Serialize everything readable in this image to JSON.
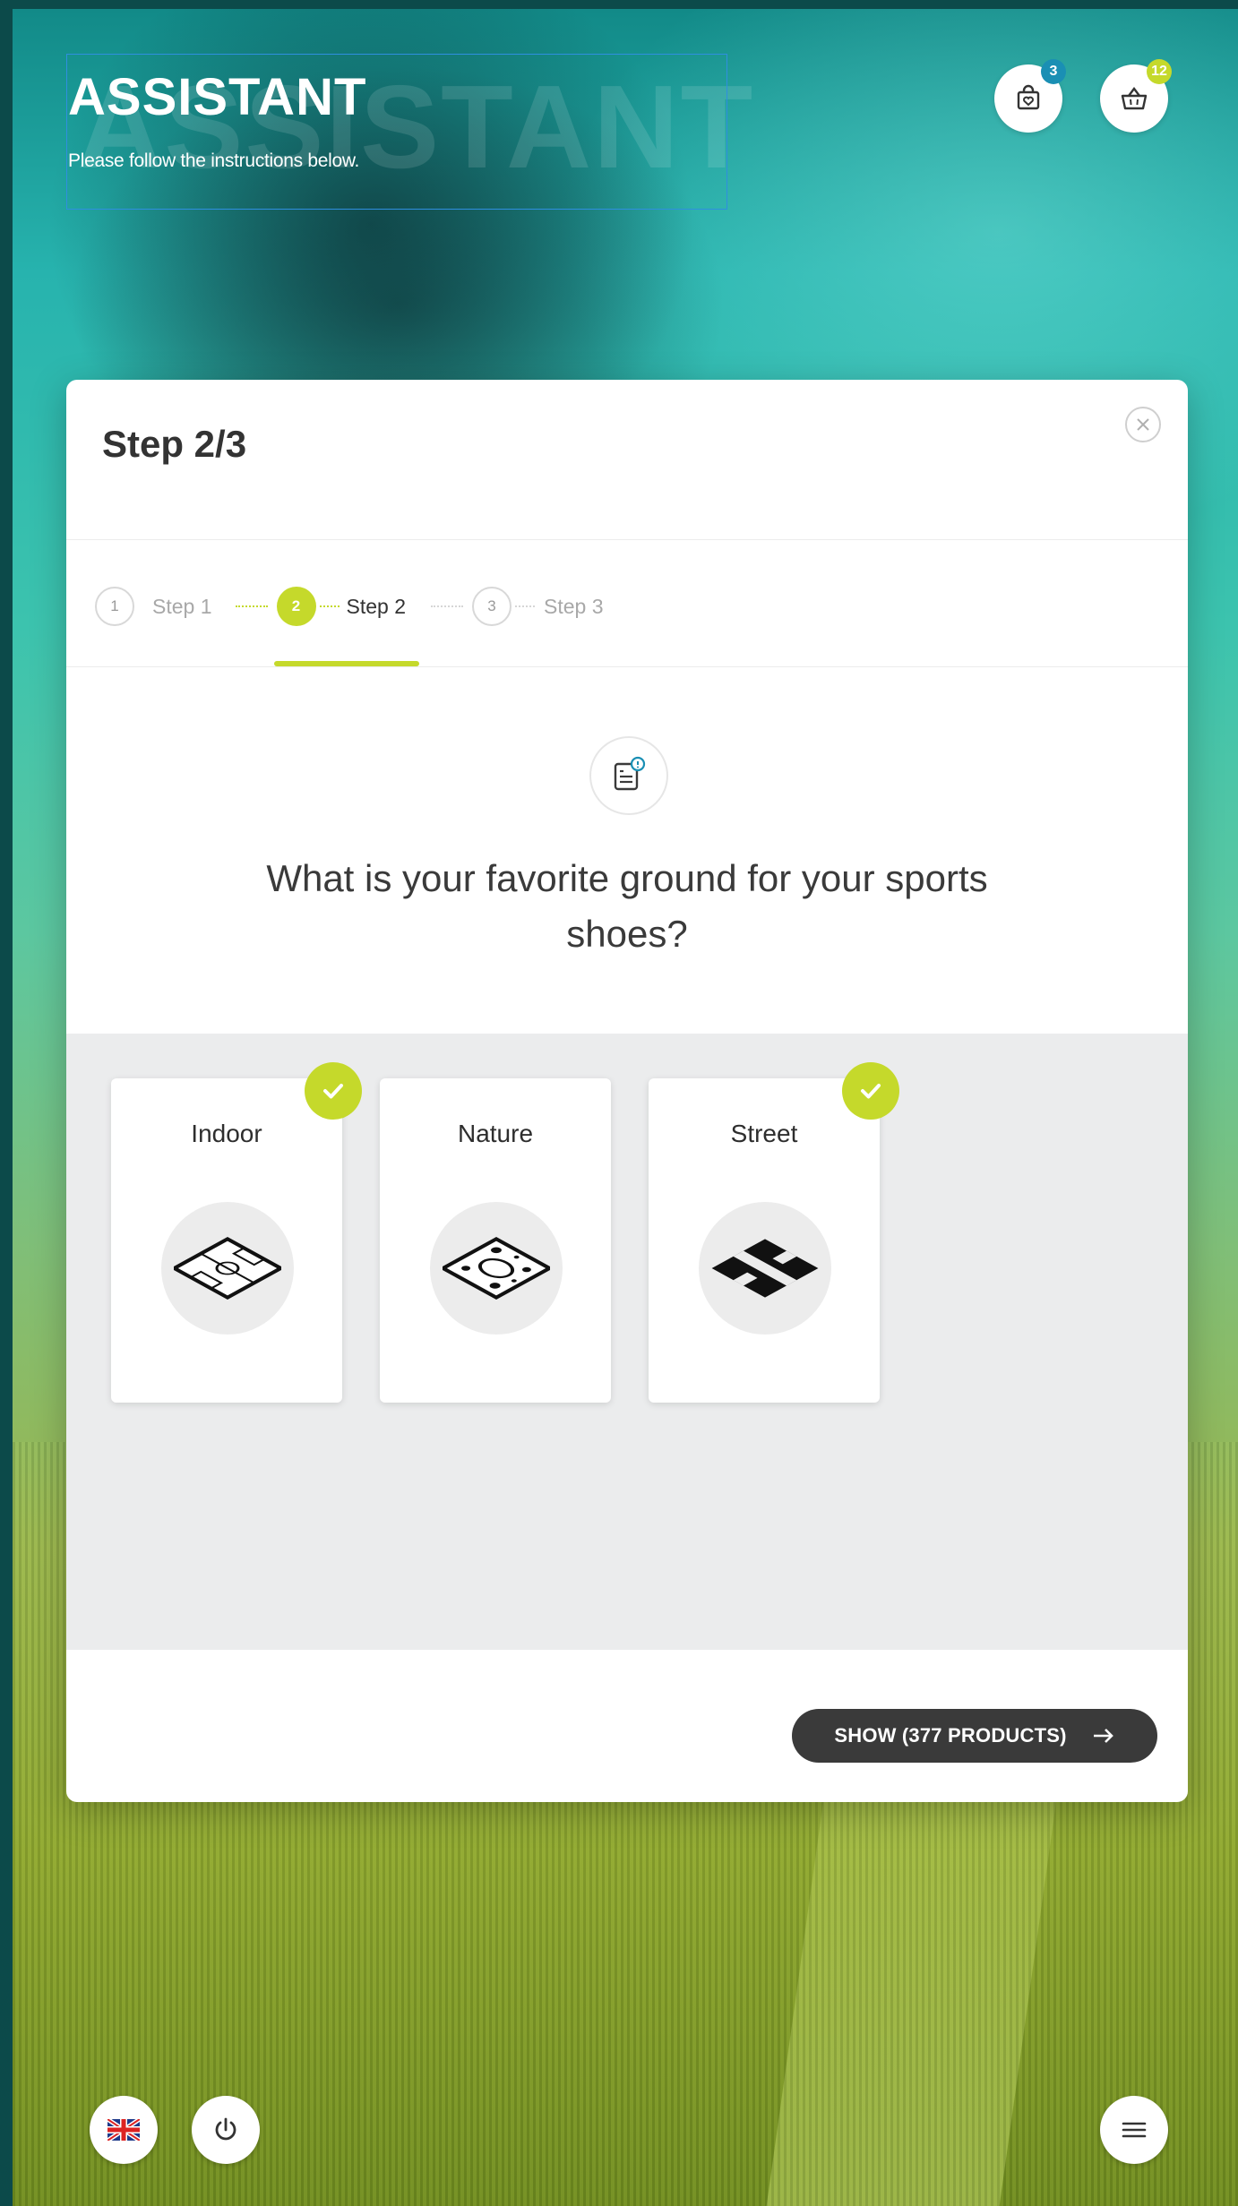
{
  "header": {
    "title": "ASSISTANT",
    "ghost_title": "ASSISTANT",
    "subtitle": "Please follow the instructions below.",
    "wishlist_count": "3",
    "cart_count": "12"
  },
  "modal": {
    "title": "Step 2/3",
    "steps": [
      {
        "num": "1",
        "label": "Step 1",
        "active": false
      },
      {
        "num": "2",
        "label": "Step 2",
        "active": true
      },
      {
        "num": "3",
        "label": "Step 3",
        "active": false
      }
    ],
    "question": "What is your favorite ground for your sports shoes?",
    "options": [
      {
        "label": "Indoor",
        "selected": true
      },
      {
        "label": "Nature",
        "selected": false
      },
      {
        "label": "Street",
        "selected": true
      }
    ],
    "show_button": "SHOW (377 PRODUCTS)"
  },
  "colors": {
    "accent": "#c5d92b",
    "badge_blue": "#1a8fb4",
    "dark_button": "#3a3a3a"
  },
  "icons": {
    "wishlist": "bag-heart-icon",
    "cart": "basket-icon",
    "close": "close-icon",
    "question": "checklist-icon",
    "check": "check-icon",
    "arrow": "arrow-right-icon",
    "language": "uk-flag-icon",
    "power": "power-icon",
    "menu": "menu-icon"
  }
}
